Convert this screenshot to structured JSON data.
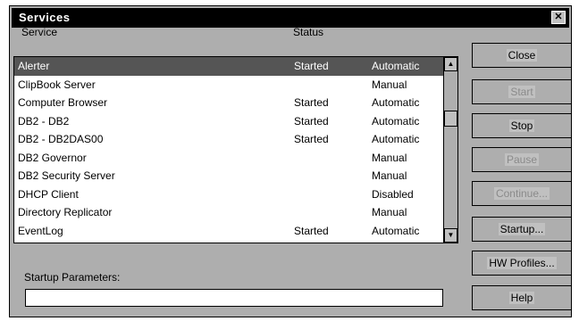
{
  "window": {
    "title": "Services",
    "close_glyph": "✕"
  },
  "columns": {
    "service": "Service",
    "status": "Status"
  },
  "services": [
    {
      "name": "Alerter",
      "status": "Started",
      "startup": "Automatic",
      "selected": true
    },
    {
      "name": "ClipBook Server",
      "status": "",
      "startup": "Manual",
      "selected": false
    },
    {
      "name": "Computer Browser",
      "status": "Started",
      "startup": "Automatic",
      "selected": false
    },
    {
      "name": "DB2 - DB2",
      "status": "Started",
      "startup": "Automatic",
      "selected": false
    },
    {
      "name": "DB2 - DB2DAS00",
      "status": "Started",
      "startup": "Automatic",
      "selected": false
    },
    {
      "name": "DB2 Governor",
      "status": "",
      "startup": "Manual",
      "selected": false
    },
    {
      "name": "DB2 Security Server",
      "status": "",
      "startup": "Manual",
      "selected": false
    },
    {
      "name": "DHCP Client",
      "status": "",
      "startup": "Disabled",
      "selected": false
    },
    {
      "name": "Directory Replicator",
      "status": "",
      "startup": "Manual",
      "selected": false
    },
    {
      "name": "EventLog",
      "status": "Started",
      "startup": "Automatic",
      "selected": false
    }
  ],
  "buttons": {
    "close": "Close",
    "start": "Start",
    "stop": "Stop",
    "pause": "Pause",
    "continue": "Continue...",
    "startup": "Startup...",
    "hw_profiles": "HW Profiles...",
    "help": "Help"
  },
  "startup_parameters": {
    "label": "Startup Parameters:",
    "value": ""
  },
  "icons": {
    "scroll_up": "▲",
    "scroll_down": "▼"
  }
}
